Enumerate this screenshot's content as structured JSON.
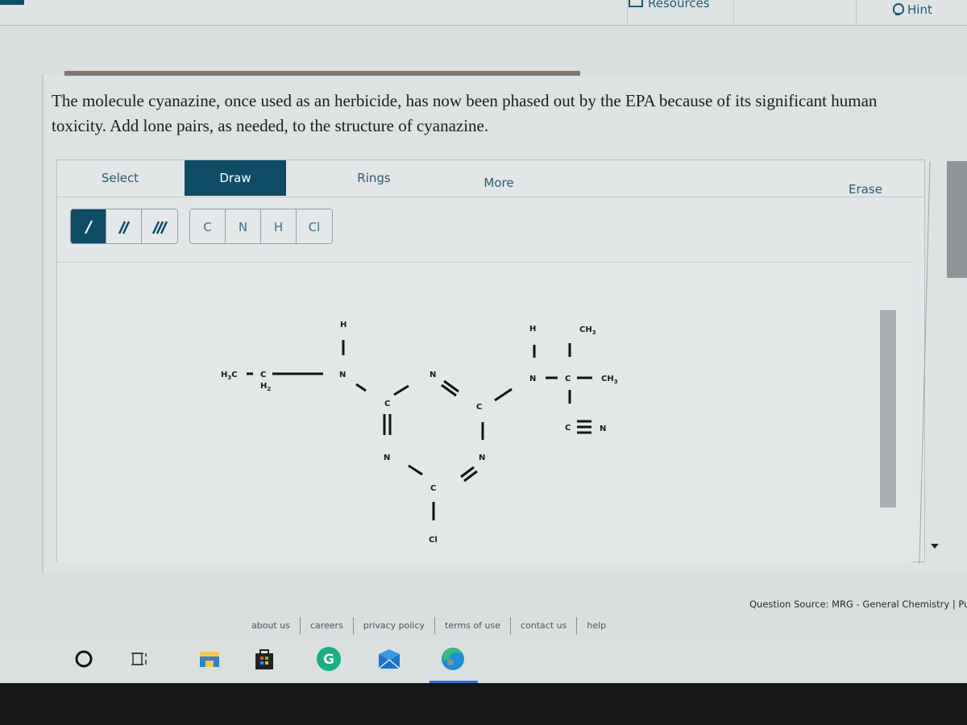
{
  "topbar": {
    "resources_label": "Resources",
    "hint_label": "Hint"
  },
  "question": {
    "text": "The molecule cyanazine, once used as an herbicide, has now been phased out by the EPA because of its significant human toxicity. Add lone pairs, as needed, to the structure of cyanazine."
  },
  "editor": {
    "tabs": [
      {
        "label": "Select",
        "active": false
      },
      {
        "label": "Draw",
        "active": true
      },
      {
        "label": "Rings",
        "active": false
      },
      {
        "label": "More",
        "active": false
      },
      {
        "label": "Erase",
        "active": false
      }
    ],
    "bond_tools": [
      {
        "name": "single-bond",
        "active": true
      },
      {
        "name": "double-bond",
        "active": false
      },
      {
        "name": "triple-bond",
        "active": false
      }
    ],
    "atom_tools": [
      "C",
      "N",
      "H",
      "Cl"
    ],
    "molecule": {
      "name": "cyanazine",
      "labels": {
        "h3c": "H",
        "h3c_sub": "3",
        "h3c_c": "C",
        "ch2_c": "C",
        "ch2_h": "H",
        "ch2_sub": "2",
        "nh_left_h": "H",
        "nh_left_n": "N",
        "ring_c_left": "C",
        "ring_n_top": "N",
        "ring_c_right": "C",
        "ring_n_right": "N",
        "ring_c_bottom": "C",
        "ring_n_left": "N",
        "cl": "Cl",
        "nh_right_h": "H",
        "nh_right_n": "N",
        "quat_c": "C",
        "ch3_top": "CH",
        "ch3_top_sub": "3",
        "ch3_right": "CH",
        "ch3_right_sub": "3",
        "nitrile_c": "C",
        "nitrile_n": "N"
      }
    }
  },
  "footer": {
    "question_source": "Question Source: MRG - General Chemistry  |  Pu",
    "links": [
      "about us",
      "careers",
      "privacy policy",
      "terms of use",
      "contact us",
      "help"
    ]
  },
  "taskbar": {
    "icons": [
      "search-circle-icon",
      "task-view-icon",
      "file-explorer-icon",
      "store-icon",
      "grammarly-icon",
      "mail-icon",
      "edge-icon"
    ]
  },
  "colors": {
    "accent": "#0e4c66",
    "link_text": "#2b5a70"
  }
}
